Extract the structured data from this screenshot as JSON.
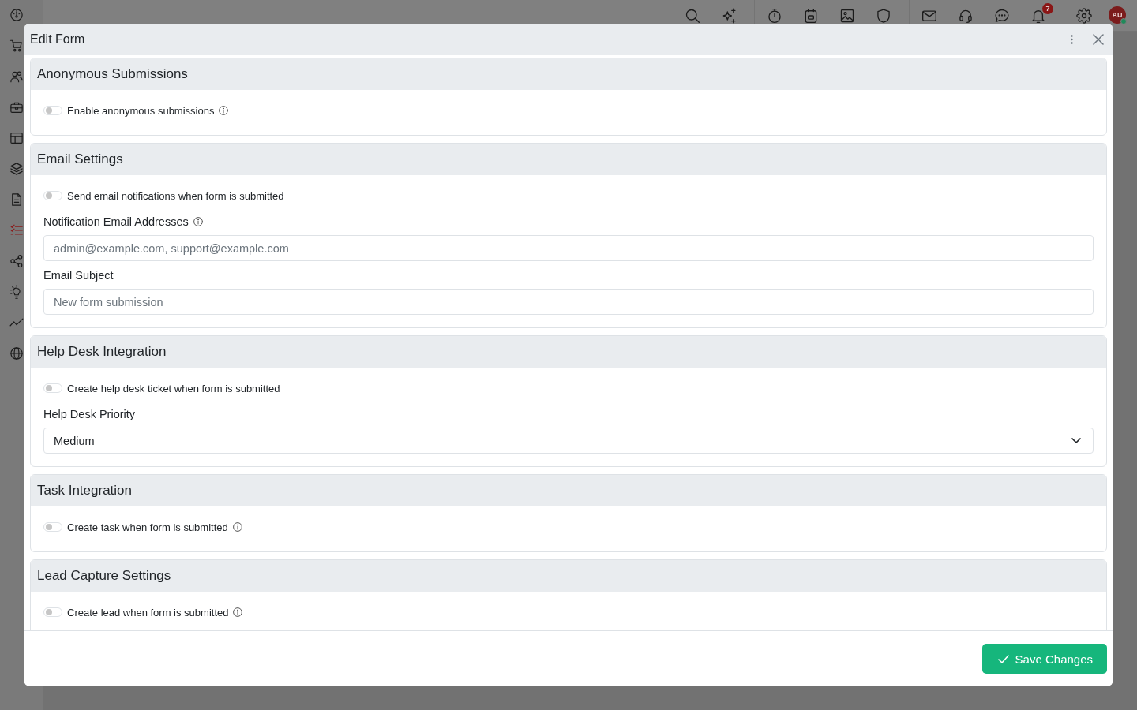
{
  "sidebar": {
    "items": [
      {
        "selected": false
      },
      {
        "selected": false
      },
      {
        "selected": false
      },
      {
        "selected": false
      },
      {
        "selected": false
      },
      {
        "selected": false
      },
      {
        "selected": false
      },
      {
        "selected": true
      },
      {
        "selected": false
      },
      {
        "selected": false
      },
      {
        "selected": false
      },
      {
        "selected": false
      }
    ]
  },
  "top_bar": {
    "notifications": {
      "count": "7"
    },
    "avatar": {
      "initials": "AU",
      "online": true
    }
  },
  "modal": {
    "title": "Edit Form",
    "sections": [
      {
        "title": "Anonymous Submissions",
        "fields": [
          {
            "kind": "toggle",
            "label": "Enable anonymous submissions",
            "on": false,
            "info": true
          }
        ]
      },
      {
        "title": "Email Settings",
        "fields": [
          {
            "kind": "toggle",
            "label": "Send email notifications when form is submitted",
            "on": false,
            "info": false
          },
          {
            "kind": "text",
            "label": "Notification Email Addresses",
            "info": true,
            "placeholder": "admin@example.com, support@example.com"
          },
          {
            "kind": "text",
            "label": "Email Subject",
            "info": false,
            "placeholder": "New form submission"
          }
        ]
      },
      {
        "title": "Help Desk Integration",
        "fields": [
          {
            "kind": "toggle",
            "label": "Create help desk ticket when form is submitted",
            "on": false,
            "info": false
          },
          {
            "kind": "select",
            "label": "Help Desk Priority",
            "info": false,
            "value": "Medium"
          }
        ]
      },
      {
        "title": "Task Integration",
        "fields": [
          {
            "kind": "toggle",
            "label": "Create task when form is submitted",
            "on": false,
            "info": true
          }
        ]
      },
      {
        "title": "Lead Capture Settings",
        "fields": [
          {
            "kind": "toggle",
            "label": "Create lead when form is submitted",
            "on": false,
            "info": true
          }
        ]
      }
    ],
    "save_button": {
      "label": "Save Changes"
    }
  }
}
